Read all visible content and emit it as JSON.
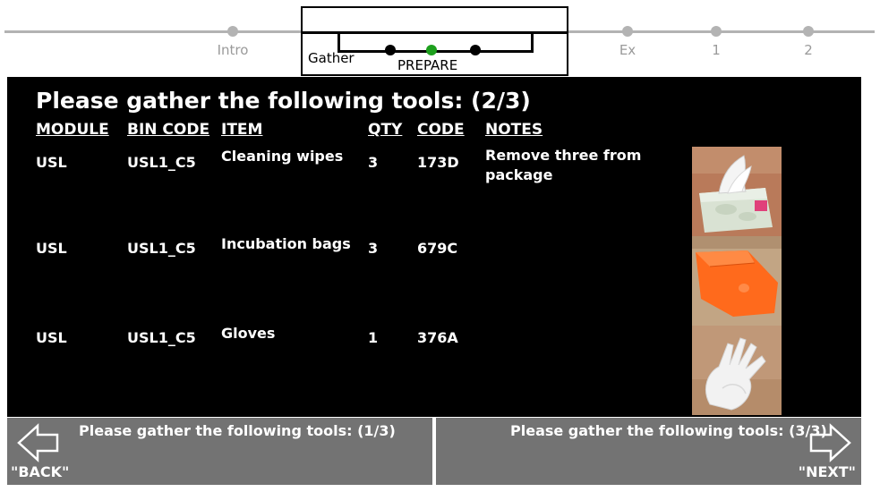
{
  "timeline": {
    "steps": [
      {
        "label": "Intro"
      },
      {
        "label": "Ex"
      },
      {
        "label": "1"
      },
      {
        "label": "2"
      }
    ],
    "zoom": {
      "group_label": "Gather",
      "current_label": "PREPARE",
      "current_color": "#1ea01e"
    }
  },
  "main": {
    "title": "Please gather the following tools: (2/3)",
    "columns": [
      "MODULE",
      "BIN CODE",
      "ITEM",
      "QTY",
      "CODE",
      "NOTES"
    ],
    "rows": [
      {
        "module": "USL",
        "bin_code": "USL1_C5",
        "item": "Cleaning wipes",
        "qty": "3",
        "code": "173D",
        "notes": "Remove three from package",
        "image": "tissue-box-photo"
      },
      {
        "module": "USL",
        "bin_code": "USL1_C5",
        "item": "Incubation bags",
        "qty": "3",
        "code": "679C",
        "notes": "",
        "image": "orange-bag-photo"
      },
      {
        "module": "USL",
        "bin_code": "USL1_C5",
        "item": "Gloves",
        "qty": "1",
        "code": "376A",
        "notes": "",
        "image": "gloves-photo"
      }
    ]
  },
  "nav": {
    "back": {
      "text": "Please gather the following tools: (1/3)",
      "key": "\"BACK\"",
      "icon": "left-arrow-icon"
    },
    "next": {
      "text": "Please gather the following tools: (3/3)",
      "key": "\"NEXT\"",
      "icon": "right-arrow-icon"
    }
  },
  "colors": {
    "panel": "#000000",
    "nav": "#737373",
    "track": "#b3b3b3",
    "current_step": "#1ea01e"
  }
}
